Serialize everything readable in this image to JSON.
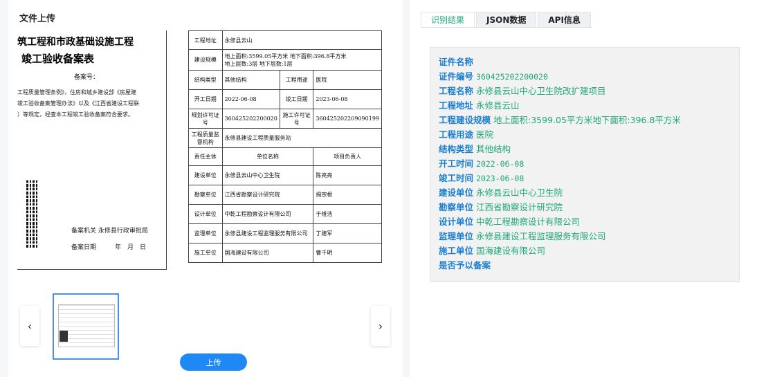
{
  "left": {
    "title": "文件上传",
    "upload_label": "上传",
    "prev_icon": "‹",
    "next_icon": "›"
  },
  "document": {
    "title_line1": "筑工程和市政基础设施工程",
    "title_line2": "竣工验收备案表",
    "record_no_label": "备案号：",
    "paragraph": [
      "工程质量管理条例》，住房和城乡建设部《房屋建",
      "竣工验收备案管理办法》以及《江西省建设工程联",
      "）等规定，经查本工程竣工验收备案符合要求。"
    ],
    "authority_line": "备案机关 永修县行政审批局",
    "date_line": "备案日期　　　年　月　日",
    "table": {
      "site_label": "工程地址",
      "site_value": "永修县云山",
      "scale_label": "建设规模",
      "scale_value_1": "地上面积:3599.05平方米 地下面积:396.8平方米",
      "scale_value_2": "地上层数:3层 地下层数:1层",
      "structure_label": "结构类型",
      "structure_value": "其他结构",
      "usage_label": "工程用途",
      "usage_value": "医院",
      "start_label": "开工日期",
      "start_value": "2022-06-08",
      "finish_label": "竣工日期",
      "finish_value": "2023-06-08",
      "plan_permit_label": "规划许可证号",
      "plan_permit_value": "360425202200020",
      "build_permit_label": "施工许可证号",
      "build_permit_value": "360425202209090199",
      "quality_label": "工程质量监督机构",
      "quality_value": "永修县建设工程质量服务站",
      "col_subject": "责任主体",
      "col_unit": "单位名称",
      "col_leader": "项目负责人",
      "rows": [
        {
          "role": "建设单位",
          "unit": "永修县云山中心卫生院",
          "person": "陈亮亮"
        },
        {
          "role": "勘察单位",
          "unit": "江西省勘察设计研究院",
          "person": "揭宗根"
        },
        {
          "role": "设计单位",
          "unit": "中乾工程勘察设计有限公司",
          "person": "于维浩"
        },
        {
          "role": "监理单位",
          "unit": "永修县建设工程监理服务有限公司",
          "person": "丁建军"
        },
        {
          "role": "施工单位",
          "unit": "国海建设有限公司",
          "person": "曹千明"
        }
      ]
    }
  },
  "tabs": [
    "识别结果",
    "JSON数据",
    "API信息"
  ],
  "result": [
    {
      "key": "证件名称",
      "value": ""
    },
    {
      "key": "证件编号",
      "value": "360425202200020"
    },
    {
      "key": "工程名称",
      "value": "永修县云山中心卫生院改扩建项目"
    },
    {
      "key": "工程地址",
      "value": "永修县云山"
    },
    {
      "key": "工程建设规模",
      "value": "地上面积:3599.05平方米地下面积:396.8平方米"
    },
    {
      "key": "工程用途",
      "value": "医院"
    },
    {
      "key": "结构类型",
      "value": "其他结构"
    },
    {
      "key": "开工时间",
      "value": "2022-06-08"
    },
    {
      "key": "竣工时间",
      "value": "2023-06-08"
    },
    {
      "key": "建设单位",
      "value": "永修县云山中心卫生院"
    },
    {
      "key": "勘察单位",
      "value": "江西省勘察设计研究院"
    },
    {
      "key": "设计单位",
      "value": "中乾工程勘察设计有限公司"
    },
    {
      "key": "监理单位",
      "value": "永修县建设工程监理服务有限公司"
    },
    {
      "key": "施工单位",
      "value": "国海建设有限公司"
    },
    {
      "key": "是否予以备案",
      "value": ""
    }
  ],
  "colors": {
    "key": "#1a7fd0",
    "value": "#1ea67b",
    "accent": "#1e88f5"
  }
}
